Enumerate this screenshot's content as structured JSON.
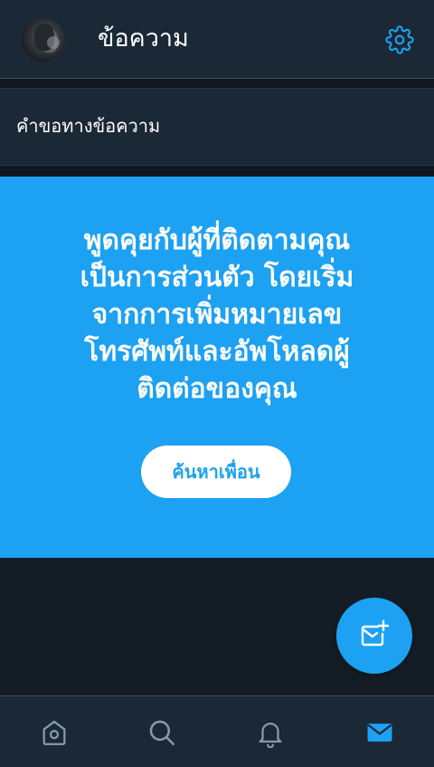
{
  "header": {
    "title": "ข้อความ",
    "avatar_icon": "profile-avatar",
    "settings_icon": "gear-icon"
  },
  "requests": {
    "label": "คำขอทางข้อความ"
  },
  "promo": {
    "lines": [
      "พูดคุยกับผู้ที่ติดตามคุณ",
      "เป็นการส่วนตัว โดยเริ่ม",
      "จากการเพิ่มหมายเลข",
      "โทรศัพท์และอัพโหลดผู้",
      "ติดต่อของคุณ"
    ],
    "button_label": "ค้นหาเพื่อน"
  },
  "fab": {
    "icon": "new-message-icon"
  },
  "bottom_nav": {
    "items": [
      {
        "icon": "home-icon",
        "active": false
      },
      {
        "icon": "search-icon",
        "active": false
      },
      {
        "icon": "bell-icon",
        "active": false
      },
      {
        "icon": "mail-icon",
        "active": true
      }
    ]
  },
  "colors": {
    "accent": "#1da1f2",
    "background": "#141d26",
    "panel": "#1b2836",
    "icon_inactive": "#8899a6"
  }
}
